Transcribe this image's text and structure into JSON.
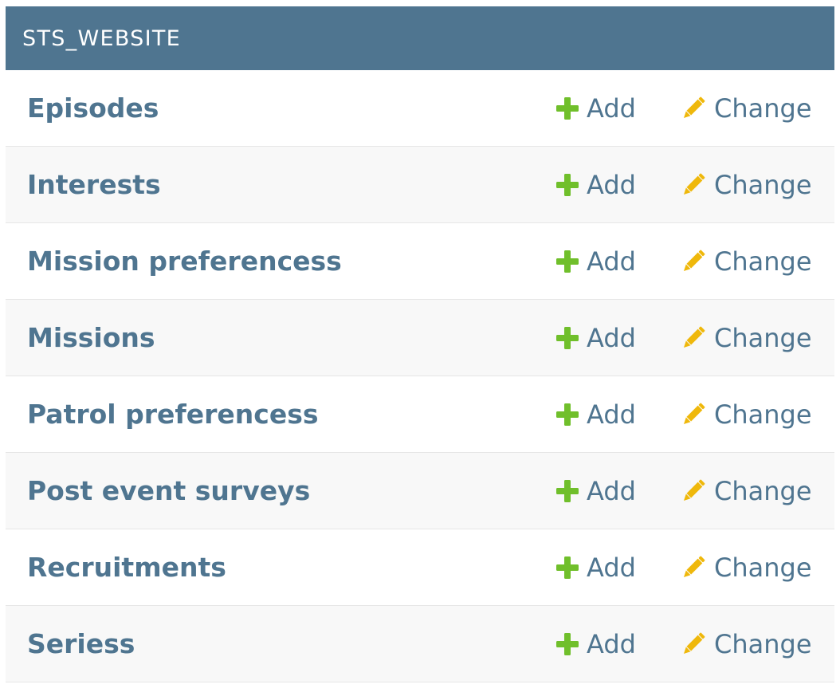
{
  "module": {
    "caption": "STS_WEBSITE",
    "colors": {
      "caption_bg": "#4f7590",
      "link": "#4f7590",
      "add_icon": "#70bf2b",
      "change_icon": "#efb80b"
    },
    "rows": [
      {
        "label": "Episodes",
        "add": "Add",
        "change": "Change"
      },
      {
        "label": "Interests",
        "add": "Add",
        "change": "Change"
      },
      {
        "label": "Mission preferencess",
        "add": "Add",
        "change": "Change"
      },
      {
        "label": "Missions",
        "add": "Add",
        "change": "Change"
      },
      {
        "label": "Patrol preferencess",
        "add": "Add",
        "change": "Change"
      },
      {
        "label": "Post event surveys",
        "add": "Add",
        "change": "Change"
      },
      {
        "label": "Recruitments",
        "add": "Add",
        "change": "Change"
      },
      {
        "label": "Seriess",
        "add": "Add",
        "change": "Change"
      }
    ],
    "icons": {
      "add": "plus-icon",
      "change": "pencil-icon"
    }
  }
}
